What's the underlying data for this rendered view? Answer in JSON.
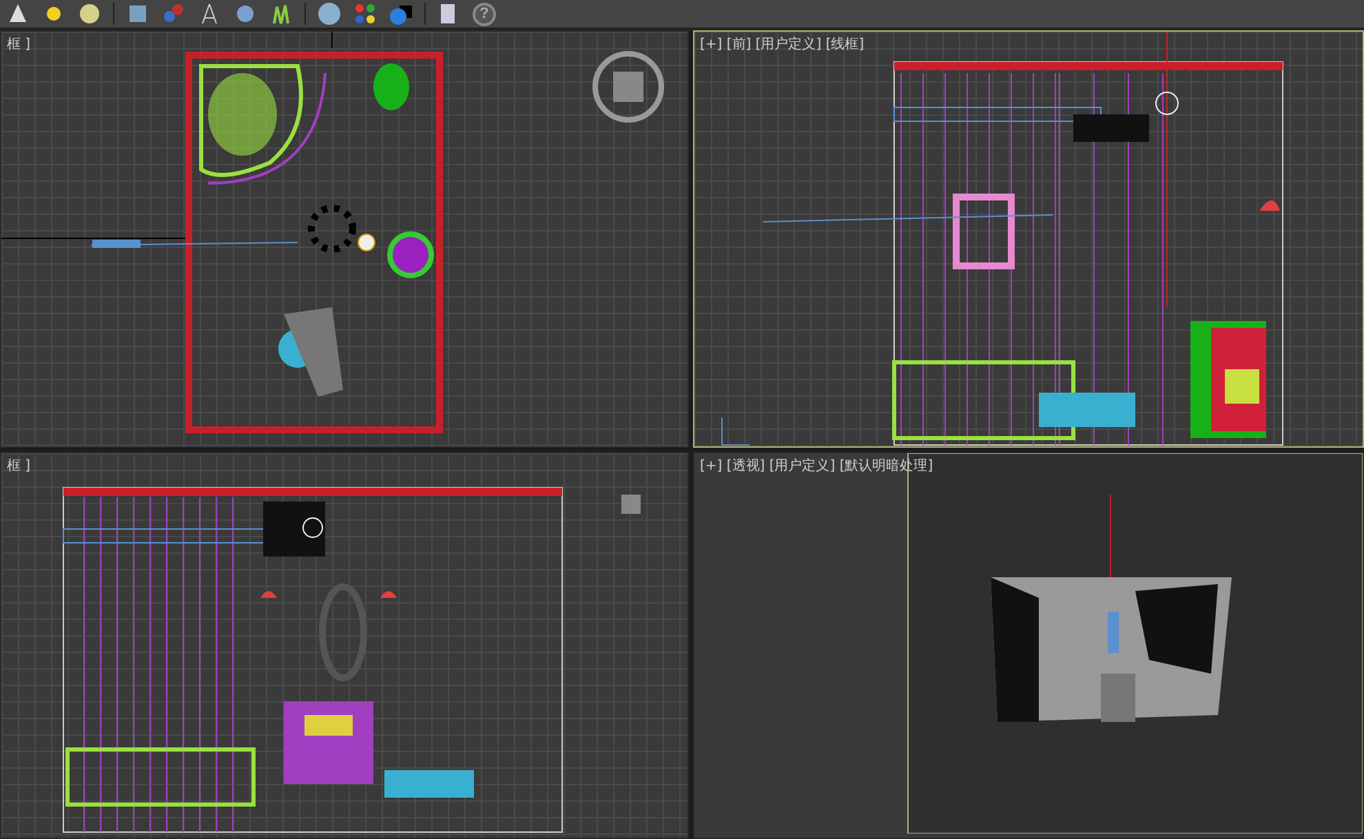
{
  "toolbar": {
    "help_label": "?"
  },
  "viewports": [
    {
      "kind": "top",
      "label": "框 ]",
      "active": false
    },
    {
      "kind": "front",
      "label": "[+] [前] [用户定义] [线框]",
      "active": true
    },
    {
      "kind": "left",
      "label": "框 ]",
      "active": false
    },
    {
      "kind": "perspective",
      "label": "[+] [透视] [用户定义] [默认明暗处理]",
      "active": false
    }
  ]
}
